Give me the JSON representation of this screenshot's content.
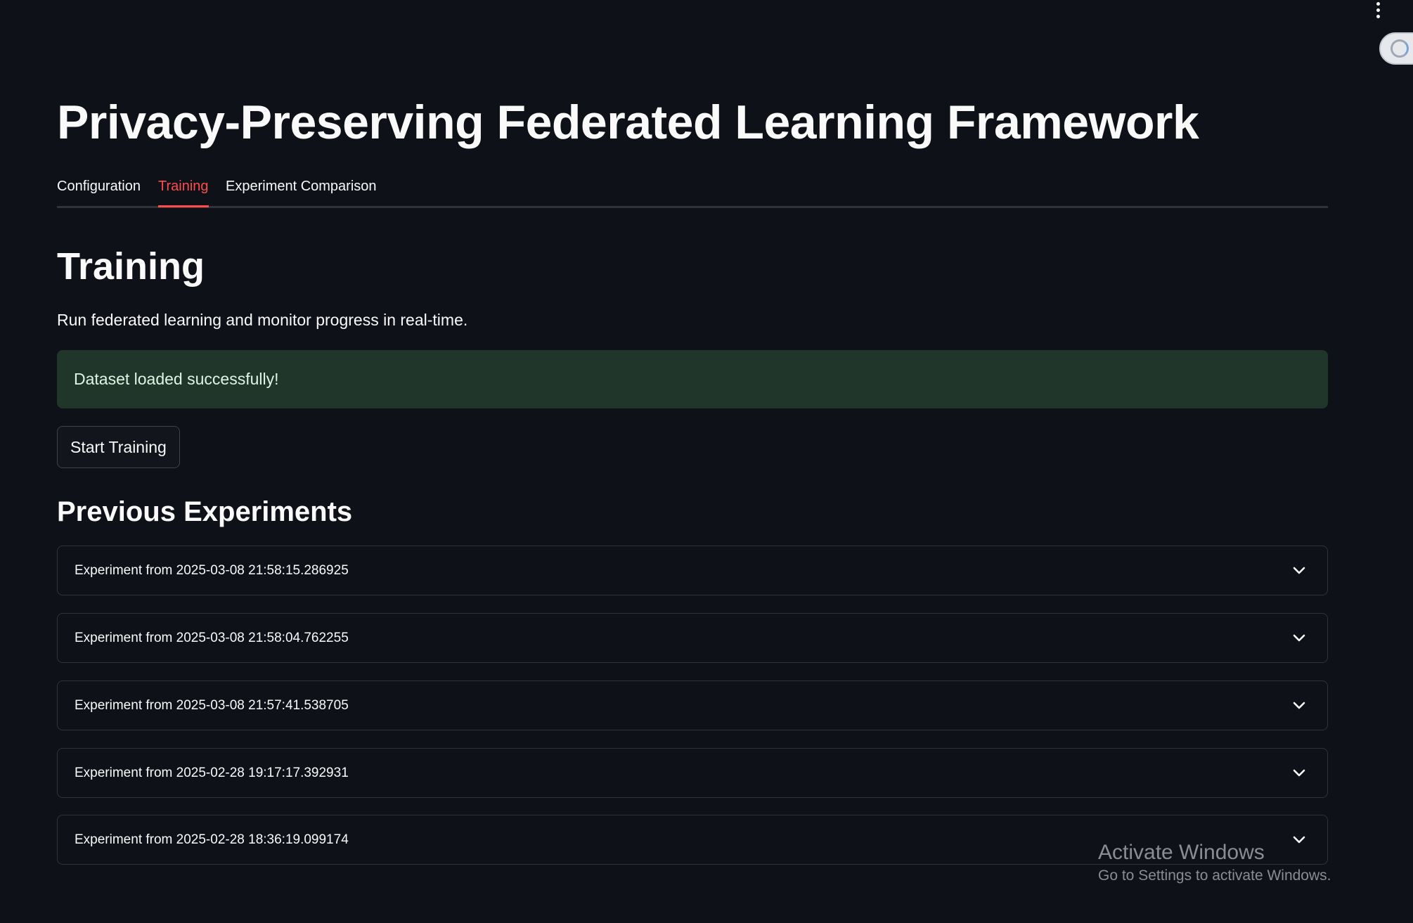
{
  "app": {
    "title": "Privacy-Preserving Federated Learning Framework"
  },
  "tabs": [
    {
      "label": "Configuration",
      "active": false
    },
    {
      "label": "Training",
      "active": true
    },
    {
      "label": "Experiment Comparison",
      "active": false
    }
  ],
  "training": {
    "heading": "Training",
    "description": "Run federated learning and monitor progress in real-time.",
    "alert": "Dataset loaded successfully!",
    "start_button": "Start Training"
  },
  "experiments": {
    "heading": "Previous Experiments",
    "items": [
      {
        "label": "Experiment from 2025-03-08 21:58:15.286925"
      },
      {
        "label": "Experiment from 2025-03-08 21:58:04.762255"
      },
      {
        "label": "Experiment from 2025-03-08 21:57:41.538705"
      },
      {
        "label": "Experiment from 2025-02-28 19:17:17.392931"
      },
      {
        "label": "Experiment from 2025-02-28 18:36:19.099174"
      }
    ]
  },
  "watermark": {
    "title": "Activate Windows",
    "subtitle": "Go to Settings to activate Windows."
  },
  "icons": {
    "menu": "more-vertical-icon",
    "status": "running-status-icon",
    "expander": "chevron-down-icon"
  },
  "colors": {
    "background": "#0e1117",
    "accent": "#ff4b4b",
    "success_bg": "#21362a",
    "border": "#31333b"
  }
}
